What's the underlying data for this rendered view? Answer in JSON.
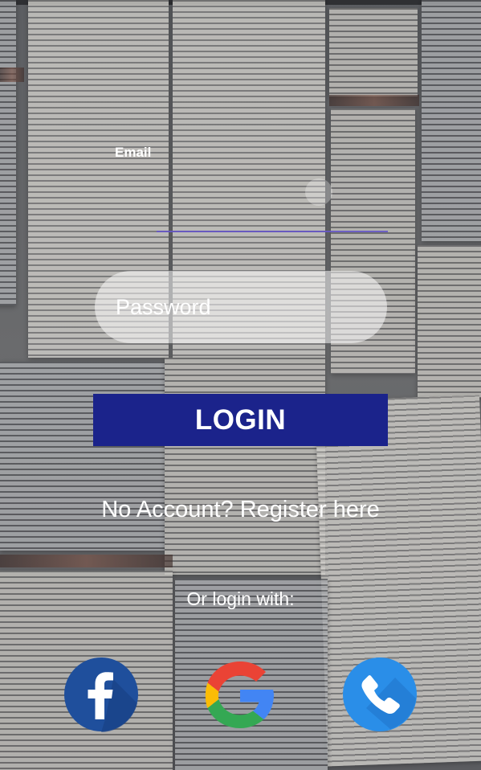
{
  "form": {
    "email_label": "Email",
    "password_placeholder": "Password",
    "login_label": "LOGIN",
    "register_text": "No Account? Register here",
    "or_login_with": "Or login with:"
  },
  "social_buttons": [
    {
      "name": "facebook",
      "icon": "facebook-icon",
      "color": "#1f4f9c"
    },
    {
      "name": "google",
      "icon": "google-icon",
      "colors": [
        "#ea4335",
        "#fbbc05",
        "#34a853",
        "#4285f4"
      ]
    },
    {
      "name": "phone",
      "icon": "phone-icon",
      "color": "#2a8ee8"
    }
  ],
  "colors": {
    "login_button": "#1b238b",
    "email_underline": "#6656c6",
    "text": "#ffffff"
  }
}
